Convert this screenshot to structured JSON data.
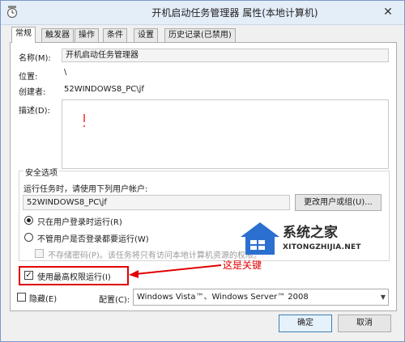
{
  "window": {
    "title": "开机启动任务管理器 属性(本地计算机)",
    "close_glyph": "✕"
  },
  "tabs": [
    "常规",
    "触发器",
    "操作",
    "条件",
    "设置",
    "历史记录(已禁用)"
  ],
  "general": {
    "name_label": "名称(M):",
    "name_value": "开机启动任务管理器",
    "location_label": "位置:",
    "location_value": "\\",
    "author_label": "创建者:",
    "author_value": "52WINDOWS8_PC\\jf",
    "description_label": "描述(D):",
    "description_value": ""
  },
  "security": {
    "group_label": "安全选项",
    "run_as_label": "运行任务时，请使用下列用户帐户:",
    "account_value": "52WINDOWS8_PC\\jf",
    "change_button": "更改用户或组(U)...",
    "radio_logged_on": "只在用户登录时运行(R)",
    "radio_whether": "不管用户是否登录都要运行(W)",
    "no_store_password": "不存储密码(P)。该任务将只有访问本地计算机资源的权限。",
    "highest_privileges": "使用最高权限运行(I)",
    "radio_logged_on_selected": true,
    "highest_privileges_checked": true
  },
  "footer": {
    "hidden_label": "隐藏(E)",
    "configure_label": "配置(C):",
    "configure_value": "Windows Vista™、Windows Server™ 2008",
    "ok_button": "确定",
    "cancel_button": "取消"
  },
  "annotation": {
    "text": "这是关键"
  },
  "watermark": {
    "title": "系统之家",
    "subtitle": "XITONGZHIJIA.NET"
  },
  "colors": {
    "accent": "#3c7fb1",
    "annotation": "#e00000",
    "title_bg": "#e4eef9"
  }
}
